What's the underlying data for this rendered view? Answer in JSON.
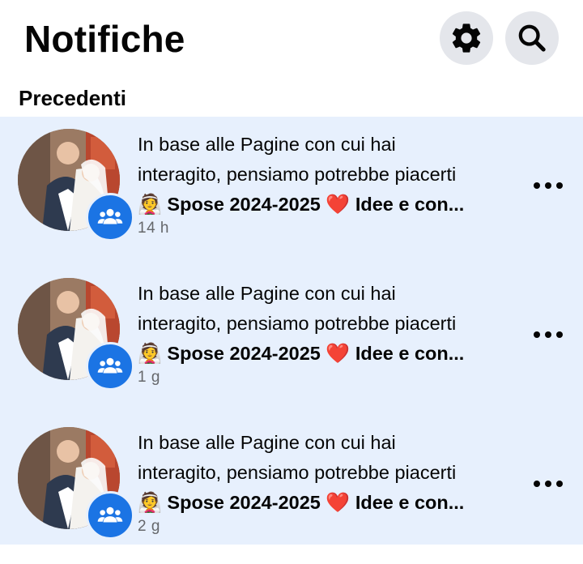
{
  "header": {
    "title": "Notifiche",
    "settings_icon": "gear-icon",
    "search_icon": "search-icon"
  },
  "section": {
    "title": "Precedenti"
  },
  "notifications": [
    {
      "line1": "In base alle Pagine con cui hai",
      "line2": "interagito, pensiamo potrebbe piacerti",
      "emoji_left": "👰",
      "page_name": "Spose 2024-2025",
      "emoji_heart": "❤️",
      "page_suffix": "Idee e con...",
      "time": "14 h"
    },
    {
      "line1": "In base alle Pagine con cui hai",
      "line2": "interagito, pensiamo potrebbe piacerti",
      "emoji_left": "👰",
      "page_name": "Spose 2024-2025",
      "emoji_heart": "❤️",
      "page_suffix": "Idee e con...",
      "time": "1 g"
    },
    {
      "line1": "In base alle Pagine con cui hai",
      "line2": "interagito, pensiamo potrebbe piacerti",
      "emoji_left": "👰",
      "page_name": "Spose 2024-2025",
      "emoji_heart": "❤️",
      "page_suffix": "Idee e con...",
      "time": "2 g"
    }
  ],
  "colors": {
    "unread_background": "#e7f0fd",
    "badge_blue": "#1b74e4",
    "icon_button_bg": "#e4e6eb",
    "time_gray": "#65676b"
  }
}
